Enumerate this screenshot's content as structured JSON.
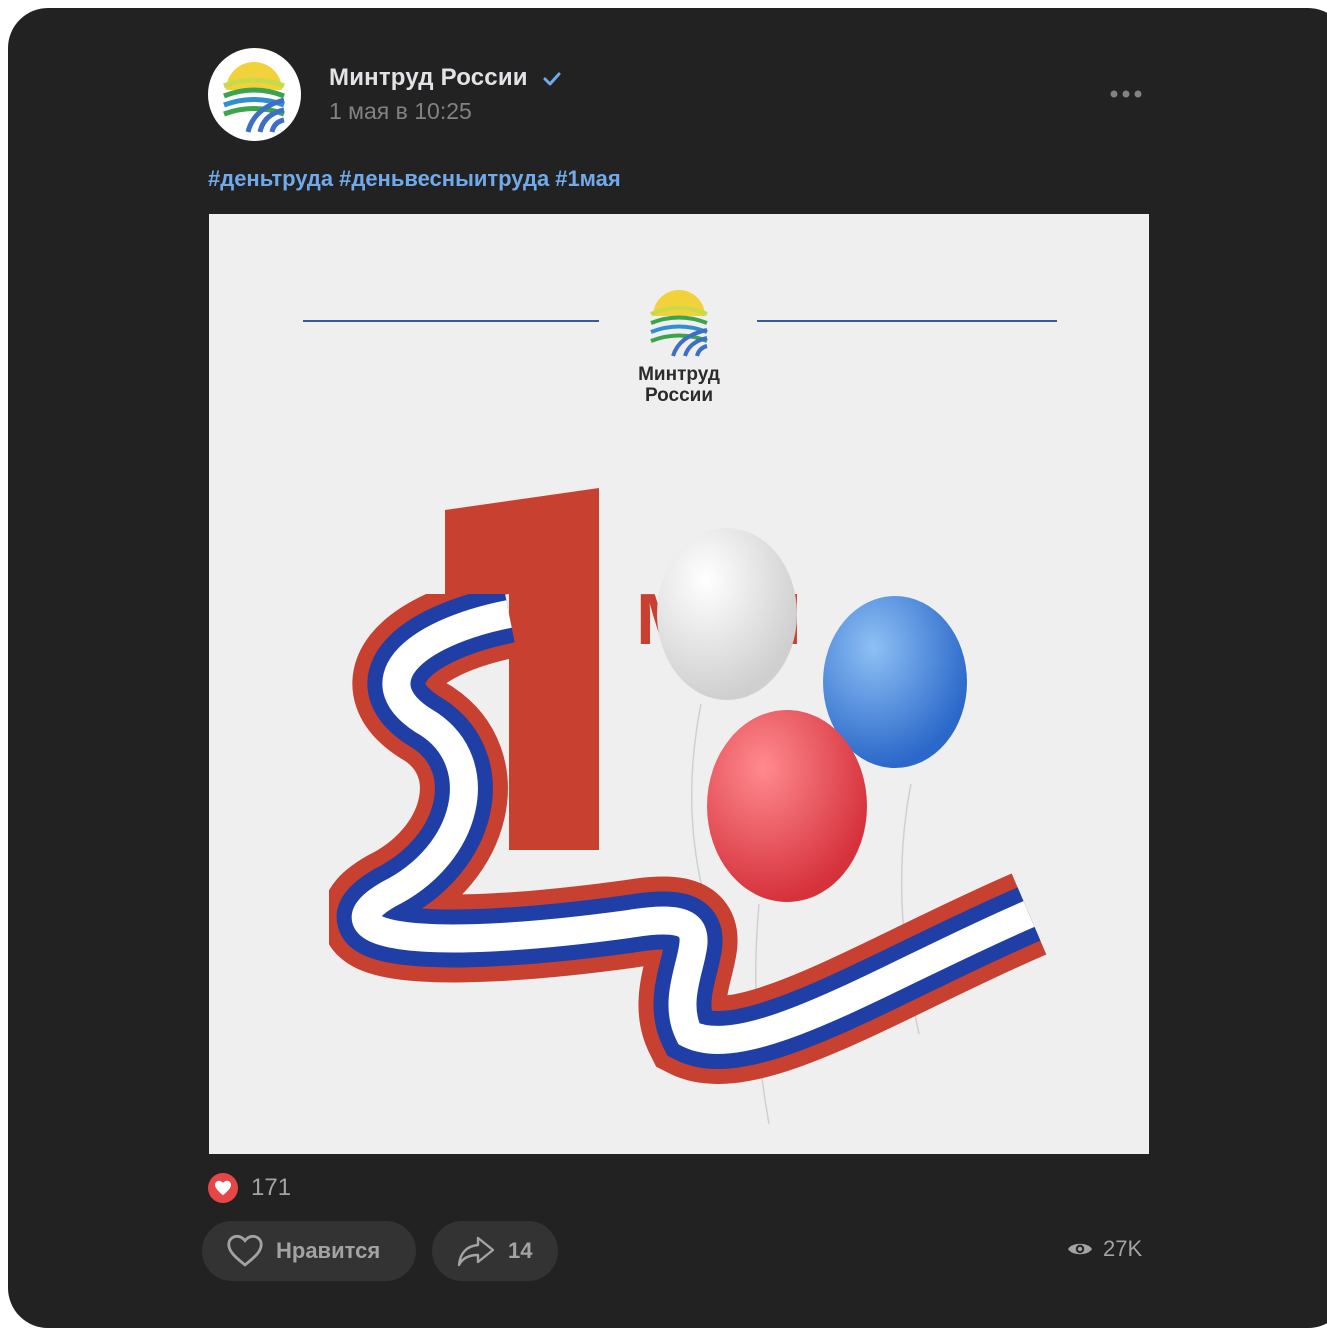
{
  "post": {
    "author": "Минтруд России",
    "date": "1 мая в 10:25",
    "hashtags": [
      "#деньтруда",
      "#деньвесныитруда",
      "#1мая"
    ]
  },
  "image": {
    "brand_line1": "Минтруд",
    "brand_line2": "России",
    "big_number": "1",
    "month": "МАЯ"
  },
  "reactions": {
    "likes_count": "171",
    "like_label": "Нравится",
    "shares_count": "14",
    "views_count": "27K"
  },
  "colors": {
    "background": "#222222",
    "accent_link": "#71aaeb",
    "like_red": "#e64646",
    "flag_white": "#ffffff",
    "flag_blue": "#1f3fa6",
    "flag_red": "#c8402f"
  },
  "icons": [
    "verified-icon",
    "more-icon",
    "heart-icon",
    "like-icon",
    "share-icon",
    "eye-icon"
  ]
}
